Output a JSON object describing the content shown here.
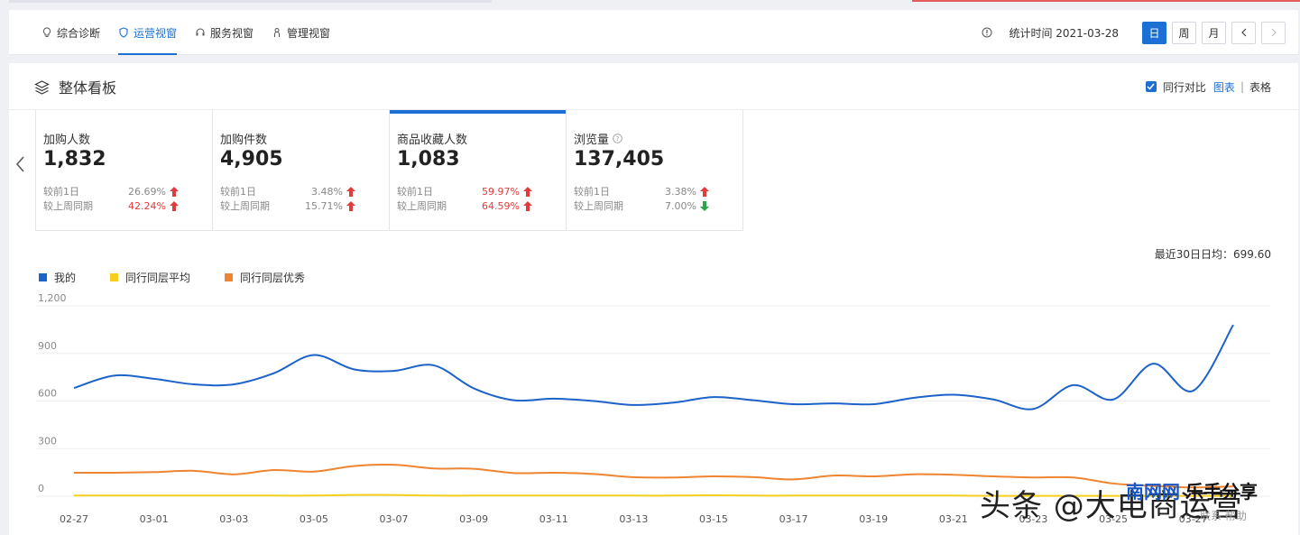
{
  "nav": {
    "tabs": [
      {
        "label": "综合诊断",
        "icon": "lightbulb-icon"
      },
      {
        "label": "运营视窗",
        "icon": "shield-icon",
        "active": true
      },
      {
        "label": "服务视窗",
        "icon": "headset-icon"
      },
      {
        "label": "管理视窗",
        "icon": "person-icon"
      }
    ],
    "stat_time": "统计时间 2021-03-28",
    "periods": [
      "日",
      "周",
      "月"
    ],
    "active_period": "日"
  },
  "panel": {
    "title": "整体看板",
    "compare_label": "同行对比",
    "view_chart": "图表",
    "view_table": "表格",
    "separator": "|"
  },
  "cards": [
    {
      "label": "加购人数",
      "value": "1,832",
      "rows": [
        {
          "label": "较前1日",
          "value": "26.69%",
          "dir": "up",
          "red": false
        },
        {
          "label": "较上周同期",
          "value": "42.24%",
          "dir": "up",
          "red": true
        }
      ]
    },
    {
      "label": "加购件数",
      "value": "4,905",
      "rows": [
        {
          "label": "较前1日",
          "value": "3.48%",
          "dir": "up",
          "red": false
        },
        {
          "label": "较上周同期",
          "value": "15.71%",
          "dir": "up",
          "red": false
        }
      ]
    },
    {
      "label": "商品收藏人数",
      "value": "1,083",
      "active": true,
      "rows": [
        {
          "label": "较前1日",
          "value": "59.97%",
          "dir": "up",
          "red": true
        },
        {
          "label": "较上周同期",
          "value": "64.59%",
          "dir": "up",
          "red": true
        }
      ]
    },
    {
      "label": "浏览量",
      "value": "137,405",
      "help": true,
      "rows": [
        {
          "label": "较前1日",
          "value": "3.38%",
          "dir": "up",
          "red": false
        },
        {
          "label": "较上周同期",
          "value": "7.00%",
          "dir": "down",
          "red": false
        }
      ]
    }
  ],
  "avg_text": "最近30日日均：699.60",
  "colors": {
    "accent": "#1c6fd5",
    "mine": "#1c62c8",
    "peer_avg": "#f5cf1c",
    "peer_top": "#ef8431",
    "up": "#e23b3b",
    "down": "#2aa54a"
  },
  "chart_data": {
    "type": "line",
    "x": [
      "02-27",
      "02-28",
      "03-01",
      "03-02",
      "03-03",
      "03-04",
      "03-05",
      "03-06",
      "03-07",
      "03-08",
      "03-09",
      "03-10",
      "03-11",
      "03-12",
      "03-13",
      "03-14",
      "03-15",
      "03-16",
      "03-17",
      "03-18",
      "03-19",
      "03-20",
      "03-21",
      "03-22",
      "03-23",
      "03-24",
      "03-25",
      "03-26",
      "03-27",
      "03-28"
    ],
    "x_tick_labels": [
      "02-27",
      "03-01",
      "03-03",
      "03-05",
      "03-07",
      "03-09",
      "03-11",
      "03-13",
      "03-15",
      "03-17",
      "03-19",
      "03-21",
      "03-23",
      "03-25",
      "03-27"
    ],
    "y_ticks": [
      "0",
      "300",
      "600",
      "900",
      "1,200"
    ],
    "ylim": [
      0,
      1200
    ],
    "series": [
      {
        "name": "我的",
        "color": "#1c62c8",
        "values": [
          682,
          760,
          740,
          705,
          705,
          775,
          890,
          800,
          790,
          825,
          680,
          605,
          615,
          600,
          575,
          590,
          625,
          605,
          580,
          585,
          580,
          620,
          640,
          610,
          550,
          700,
          610,
          835,
          665,
          1080
        ]
      },
      {
        "name": "同行同层平均",
        "color": "#f5cf1c",
        "values": [
          4,
          4,
          4,
          4,
          4,
          4,
          4,
          8,
          8,
          4,
          4,
          4,
          4,
          4,
          4,
          4,
          6,
          4,
          4,
          4,
          4,
          4,
          4,
          2,
          2,
          2,
          2,
          2,
          2,
          2
        ]
      },
      {
        "name": "同行同层优秀",
        "color": "#ef8431",
        "values": [
          148,
          148,
          152,
          160,
          138,
          165,
          155,
          190,
          198,
          175,
          173,
          146,
          148,
          140,
          120,
          118,
          125,
          120,
          106,
          130,
          125,
          138,
          135,
          125,
          118,
          118,
          80,
          65,
          55,
          62
        ]
      }
    ]
  },
  "watermark": {
    "text1": "头条 @大电商运营",
    "text2a": "南网网",
    "text2b": "乐手分享",
    "text3": "联系 帮助"
  }
}
